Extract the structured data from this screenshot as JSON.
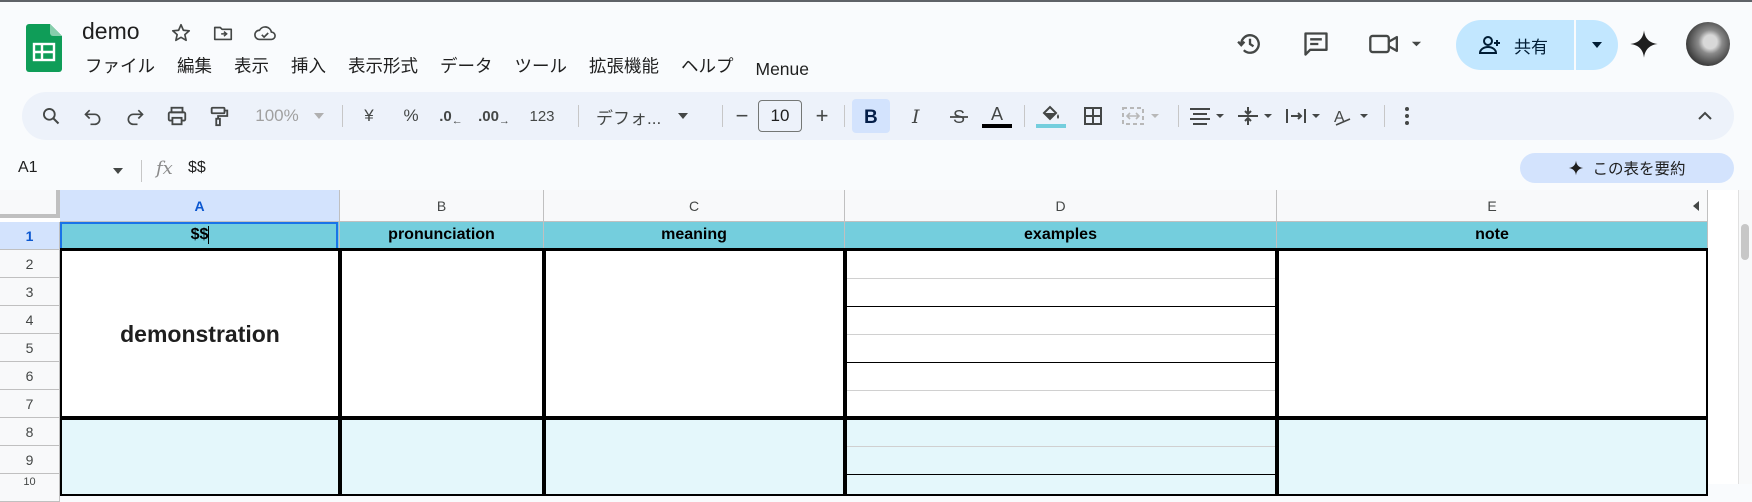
{
  "app": {
    "doc_title": "demo",
    "menus": [
      "ファイル",
      "編集",
      "表示",
      "挿入",
      "表示形式",
      "データ",
      "ツール",
      "拡張機能",
      "ヘルプ",
      "Menue"
    ],
    "share_label": "共有"
  },
  "toolbar": {
    "zoom": "100%",
    "currency": "¥",
    "percent": "%",
    "decrease_decimal": ".0",
    "increase_decimal": ".00",
    "number_format": "123",
    "font": "デフォ...",
    "font_size": "10",
    "minus": "−",
    "plus": "+"
  },
  "formula_bar": {
    "cell_ref": "A1",
    "fx": "fx",
    "value": "$$",
    "summarize_label": "この表を要約"
  },
  "sheet": {
    "columns": [
      "A",
      "B",
      "C",
      "D",
      "E"
    ],
    "rows": [
      "1",
      "2",
      "3",
      "4",
      "5",
      "6",
      "7",
      "8",
      "9",
      "10"
    ],
    "header_row": [
      "$$",
      "pronunciation",
      "meaning",
      "examples",
      "note"
    ],
    "merged_a2_a7": "demonstration",
    "selected_cell": "A1"
  },
  "colors": {
    "header_fill": "#74cedd",
    "alt_block_fill": "#e4f7fb",
    "selection": "#1a73e8",
    "share_bg": "#c2e7ff"
  },
  "icons": [
    "sheets-logo-icon",
    "star-icon",
    "move-folder-icon",
    "cloud-status-icon",
    "history-icon",
    "comment-icon",
    "meet-icon",
    "person-add-icon",
    "gemini-icon",
    "search-icon",
    "undo-icon",
    "redo-icon",
    "print-icon",
    "paint-format-icon",
    "bold-icon",
    "italic-icon",
    "strikethrough-icon",
    "text-color-icon",
    "fill-color-icon",
    "borders-icon",
    "merge-icon",
    "align-icon",
    "valign-icon",
    "wrap-icon",
    "rotate-icon",
    "more-icon",
    "collapse-icon"
  ]
}
